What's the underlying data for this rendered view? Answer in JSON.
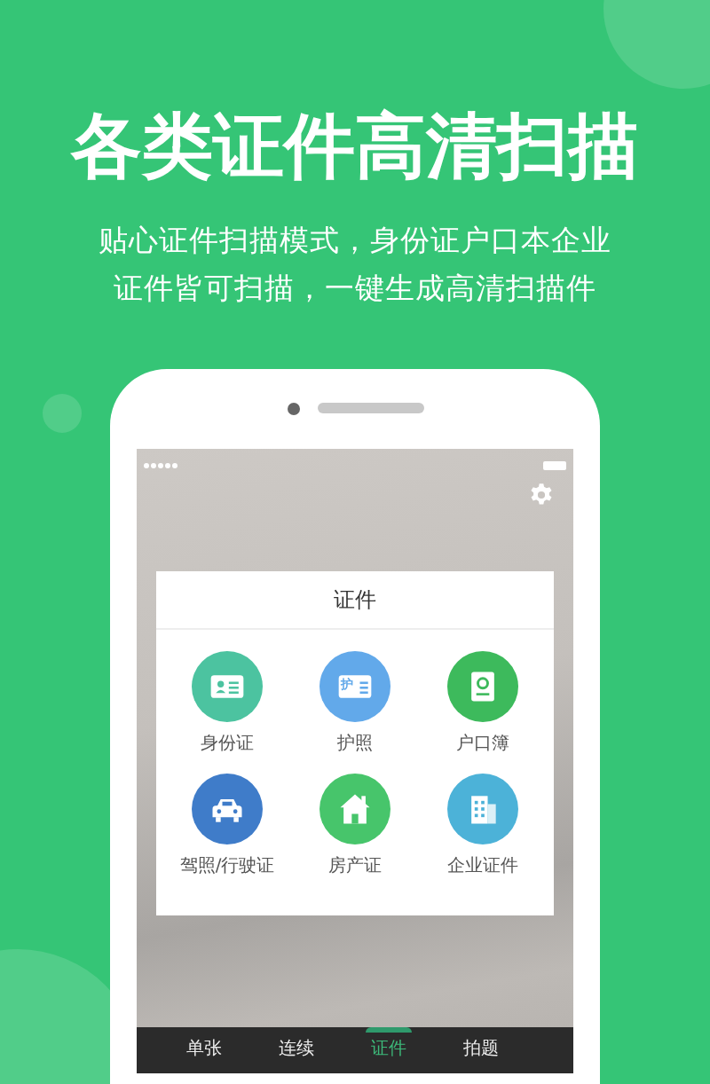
{
  "headline": "各类证件高清扫描",
  "subtitle": "贴心证件扫描模式，身份证户口本企业证件皆可扫描，一键生成高清扫描件",
  "card": {
    "title": "证件",
    "items": [
      {
        "label": "身份证",
        "kind": "id-card",
        "color": "#4cc3a0"
      },
      {
        "label": "护照",
        "kind": "passport",
        "color": "#62a9ea",
        "glyph": "护"
      },
      {
        "label": "户口簿",
        "kind": "booklet",
        "color": "#3dba5c"
      },
      {
        "label": "驾照/行驶证",
        "kind": "car",
        "color": "#3f7cc9"
      },
      {
        "label": "房产证",
        "kind": "house",
        "color": "#47c56b"
      },
      {
        "label": "企业证件",
        "kind": "building",
        "color": "#4cb2d8"
      }
    ]
  },
  "tabs": [
    {
      "label": "单张",
      "selected": false
    },
    {
      "label": "连续",
      "selected": false
    },
    {
      "label": "证件",
      "selected": true
    },
    {
      "label": "拍题",
      "selected": false
    }
  ]
}
